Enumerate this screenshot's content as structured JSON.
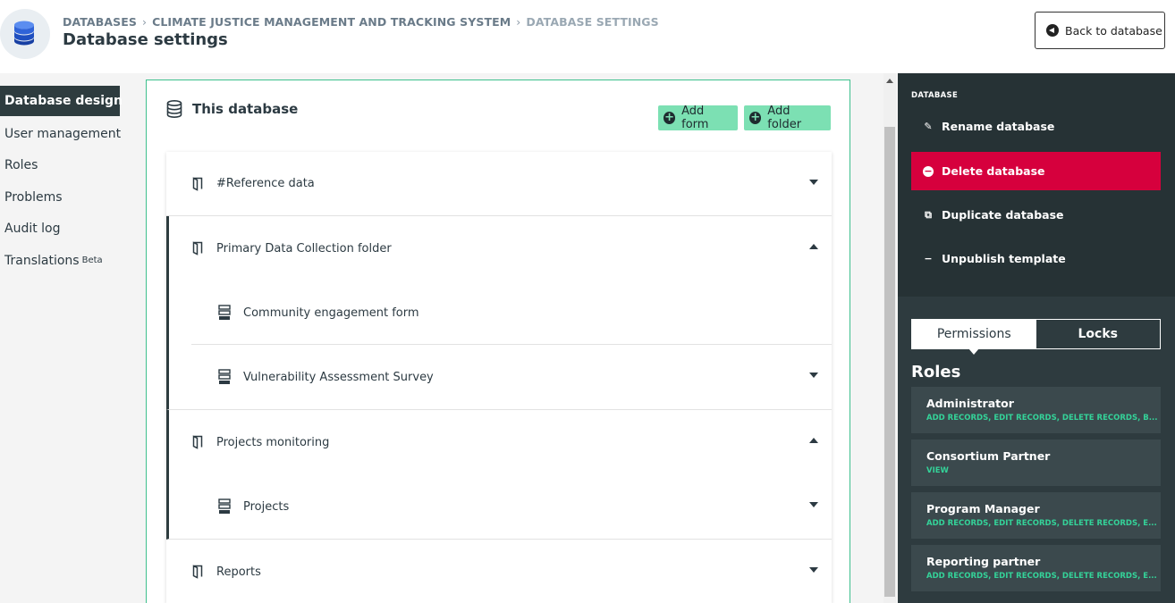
{
  "header": {
    "breadcrumb": [
      "DATABASES",
      "CLIMATE JUSTICE MANAGEMENT AND TRACKING SYSTEM",
      "DATABASE SETTINGS"
    ],
    "title": "Database settings",
    "back_label": "Back to database"
  },
  "leftnav": {
    "items": [
      {
        "label": "Database design",
        "active": true
      },
      {
        "label": "User management"
      },
      {
        "label": "Roles"
      },
      {
        "label": "Problems"
      },
      {
        "label": "Audit log"
      },
      {
        "label": "Translations",
        "sup": "Beta"
      }
    ]
  },
  "main": {
    "title": "This database",
    "add_form": "Add form",
    "add_folder": "Add folder",
    "tree": {
      "reference": "#Reference data",
      "primary_folder": "Primary Data Collection folder",
      "form_community": "Community engagement form",
      "form_vulnerability": "Vulnerability Assessment Survey",
      "projects_folder": "Projects monitoring",
      "form_projects": "Projects",
      "reports": "Reports"
    }
  },
  "right": {
    "section": "DATABASE",
    "actions": {
      "rename": "Rename database",
      "delete": "Delete database",
      "duplicate": "Duplicate database",
      "unpublish": "Unpublish template"
    },
    "tabs": {
      "permissions": "Permissions",
      "locks": "Locks"
    },
    "roles_title": "Roles",
    "roles": [
      {
        "name": "Administrator",
        "perms": "ADD RECORDS, EDIT RECORDS, DELETE RECORDS, B..."
      },
      {
        "name": "Consortium Partner",
        "perms": "VIEW"
      },
      {
        "name": "Program Manager",
        "perms": "ADD RECORDS, EDIT RECORDS, DELETE RECORDS, E..."
      },
      {
        "name": "Reporting partner",
        "perms": "ADD RECORDS, EDIT RECORDS, DELETE RECORDS, E..."
      }
    ]
  },
  "colors": {
    "accent": "#7ce0b3",
    "danger": "#d6003d",
    "dark": "#2e3b3f",
    "green_text": "#34d399"
  }
}
